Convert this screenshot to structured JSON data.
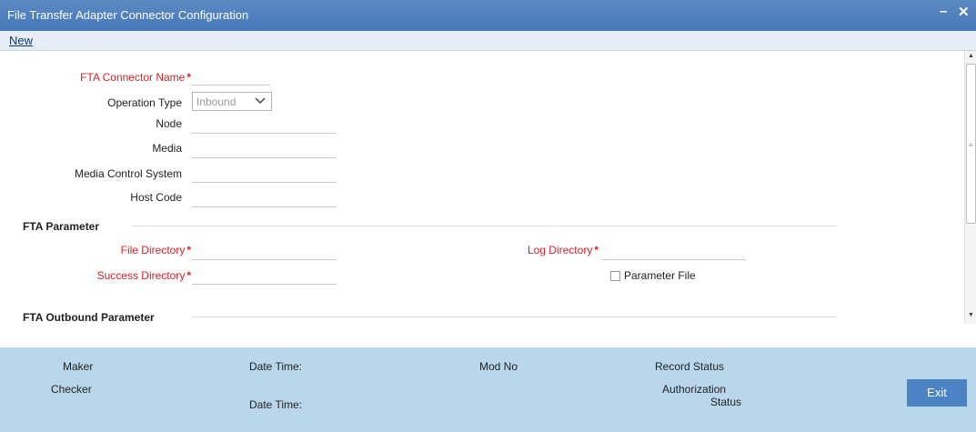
{
  "window": {
    "title": "File Transfer Adapter Connector Configuration",
    "min_label": "–",
    "close_label": "✕"
  },
  "menu": {
    "new_label": "New"
  },
  "form": {
    "connector_name_label": "FTA Connector Name",
    "required_marker": "*",
    "operation_type_label": "Operation Type",
    "operation_type_value": "Inbound",
    "node_label": "Node",
    "media_label": "Media",
    "media_control_label": "Media Control System",
    "host_code_label": "Host Code"
  },
  "fta_parameter": {
    "heading": "FTA Parameter",
    "file_directory_label": "File Directory",
    "success_directory_label": "Success Directory",
    "log_directory_label": "Log Directory",
    "parameter_file_label": "Parameter File",
    "parameter_file_checked": false
  },
  "fta_outbound": {
    "heading": "FTA Outbound Parameter"
  },
  "footer": {
    "maker_label": "Maker",
    "checker_label": "Checker",
    "date_time_label_1": "Date Time:",
    "date_time_label_2": "Date Time:",
    "mod_no_label": "Mod No",
    "record_status_label": "Record Status",
    "authorization_label_line1": "Authorization",
    "authorization_label_line2": "Status",
    "exit_label": "Exit"
  },
  "colors": {
    "title_bar": "#4677b8",
    "footer": "#b9d6ea",
    "required": "#d2232a",
    "exit_button": "#4b83c4"
  }
}
